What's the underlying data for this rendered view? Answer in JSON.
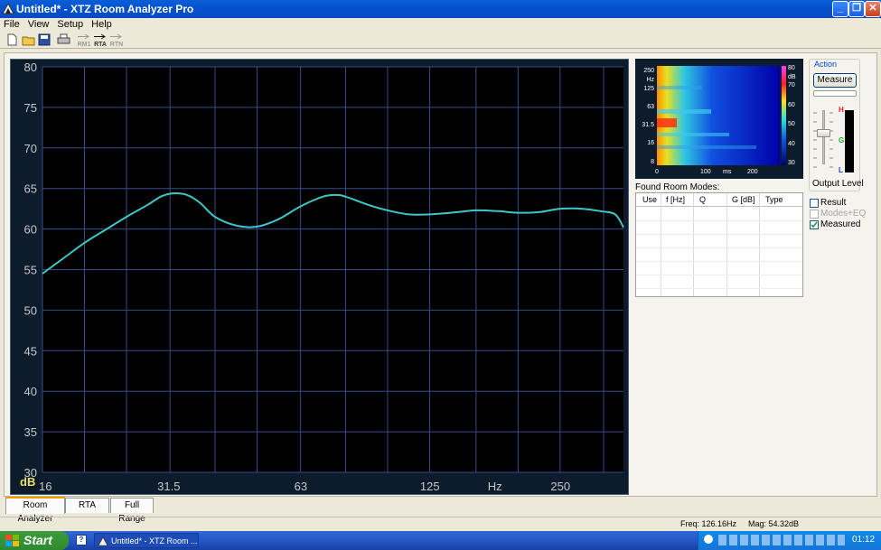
{
  "window": {
    "title": "Untitled* - XTZ Room Analyzer Pro"
  },
  "menu": {
    "items": [
      "File",
      "View",
      "Setup",
      "Help"
    ]
  },
  "toolbar": {
    "rm_label": "RM1",
    "rta_label": "RTA",
    "rtn_label": "RTN"
  },
  "main_chart": {
    "unit_label": "dB",
    "y_ticks": [
      "80",
      "75",
      "70",
      "65",
      "60",
      "55",
      "50",
      "45",
      "40",
      "35",
      "30"
    ],
    "x_ticks": [
      "16",
      "31.5",
      "63",
      "125",
      "Hz",
      "250"
    ]
  },
  "chart_data": {
    "type": "line",
    "x_scale": "log",
    "xlim": [
      16,
      350
    ],
    "ylim": [
      30,
      80
    ],
    "grid": true,
    "series": [
      {
        "color": "#3fc6c6",
        "x": [
          16,
          18,
          20,
          22.5,
          25,
          28,
          30,
          32,
          34.5,
          37,
          40,
          45,
          50,
          56,
          63,
          71,
          76,
          80,
          90,
          100,
          112,
          125,
          140,
          160,
          180,
          200,
          225,
          250,
          280,
          310,
          335,
          350
        ],
        "y": [
          54.5,
          56.5,
          58.3,
          60,
          61.5,
          63,
          64,
          64.4,
          64.2,
          63.2,
          61.5,
          60.4,
          60.3,
          61.2,
          62.8,
          64,
          64.2,
          64,
          63,
          62.3,
          61.8,
          61.8,
          62,
          62.3,
          62.2,
          62,
          62.1,
          62.5,
          62.5,
          62.2,
          61.8,
          60.2
        ]
      }
    ]
  },
  "spectrogram": {
    "y_ticks": [
      "250",
      "Hz",
      "125",
      "63",
      "31.5",
      "16",
      "8"
    ],
    "x_ticks": [
      "0",
      "100",
      "ms",
      "200"
    ],
    "scale_ticks": [
      "80",
      "dB",
      "70",
      "60",
      "50",
      "40",
      "30"
    ]
  },
  "room_modes": {
    "label": "Found Room Modes:",
    "columns": [
      "Use",
      "f [Hz]",
      "Q",
      "G [dB]",
      "Type"
    ],
    "rows": []
  },
  "action": {
    "group_label": "Action",
    "measure_label": "Measure",
    "output_level_label": "Output Level",
    "meter_tags": [
      "H",
      "G",
      "L"
    ],
    "checkboxes": [
      {
        "label": "Result",
        "checked": false,
        "enabled": true
      },
      {
        "label": "Modes+EQ",
        "checked": false,
        "enabled": false
      },
      {
        "label": "Measured",
        "checked": true,
        "enabled": true
      }
    ]
  },
  "tabs": [
    "Room Analyzer",
    "RTA",
    "Full Range"
  ],
  "status": {
    "freq": "Freq: 126.16Hz",
    "mag": "Mag: 54.32dB"
  },
  "taskbar": {
    "start_label": "Start",
    "task_label": "Untitled* - XTZ Room ...",
    "clock": "01:12"
  }
}
